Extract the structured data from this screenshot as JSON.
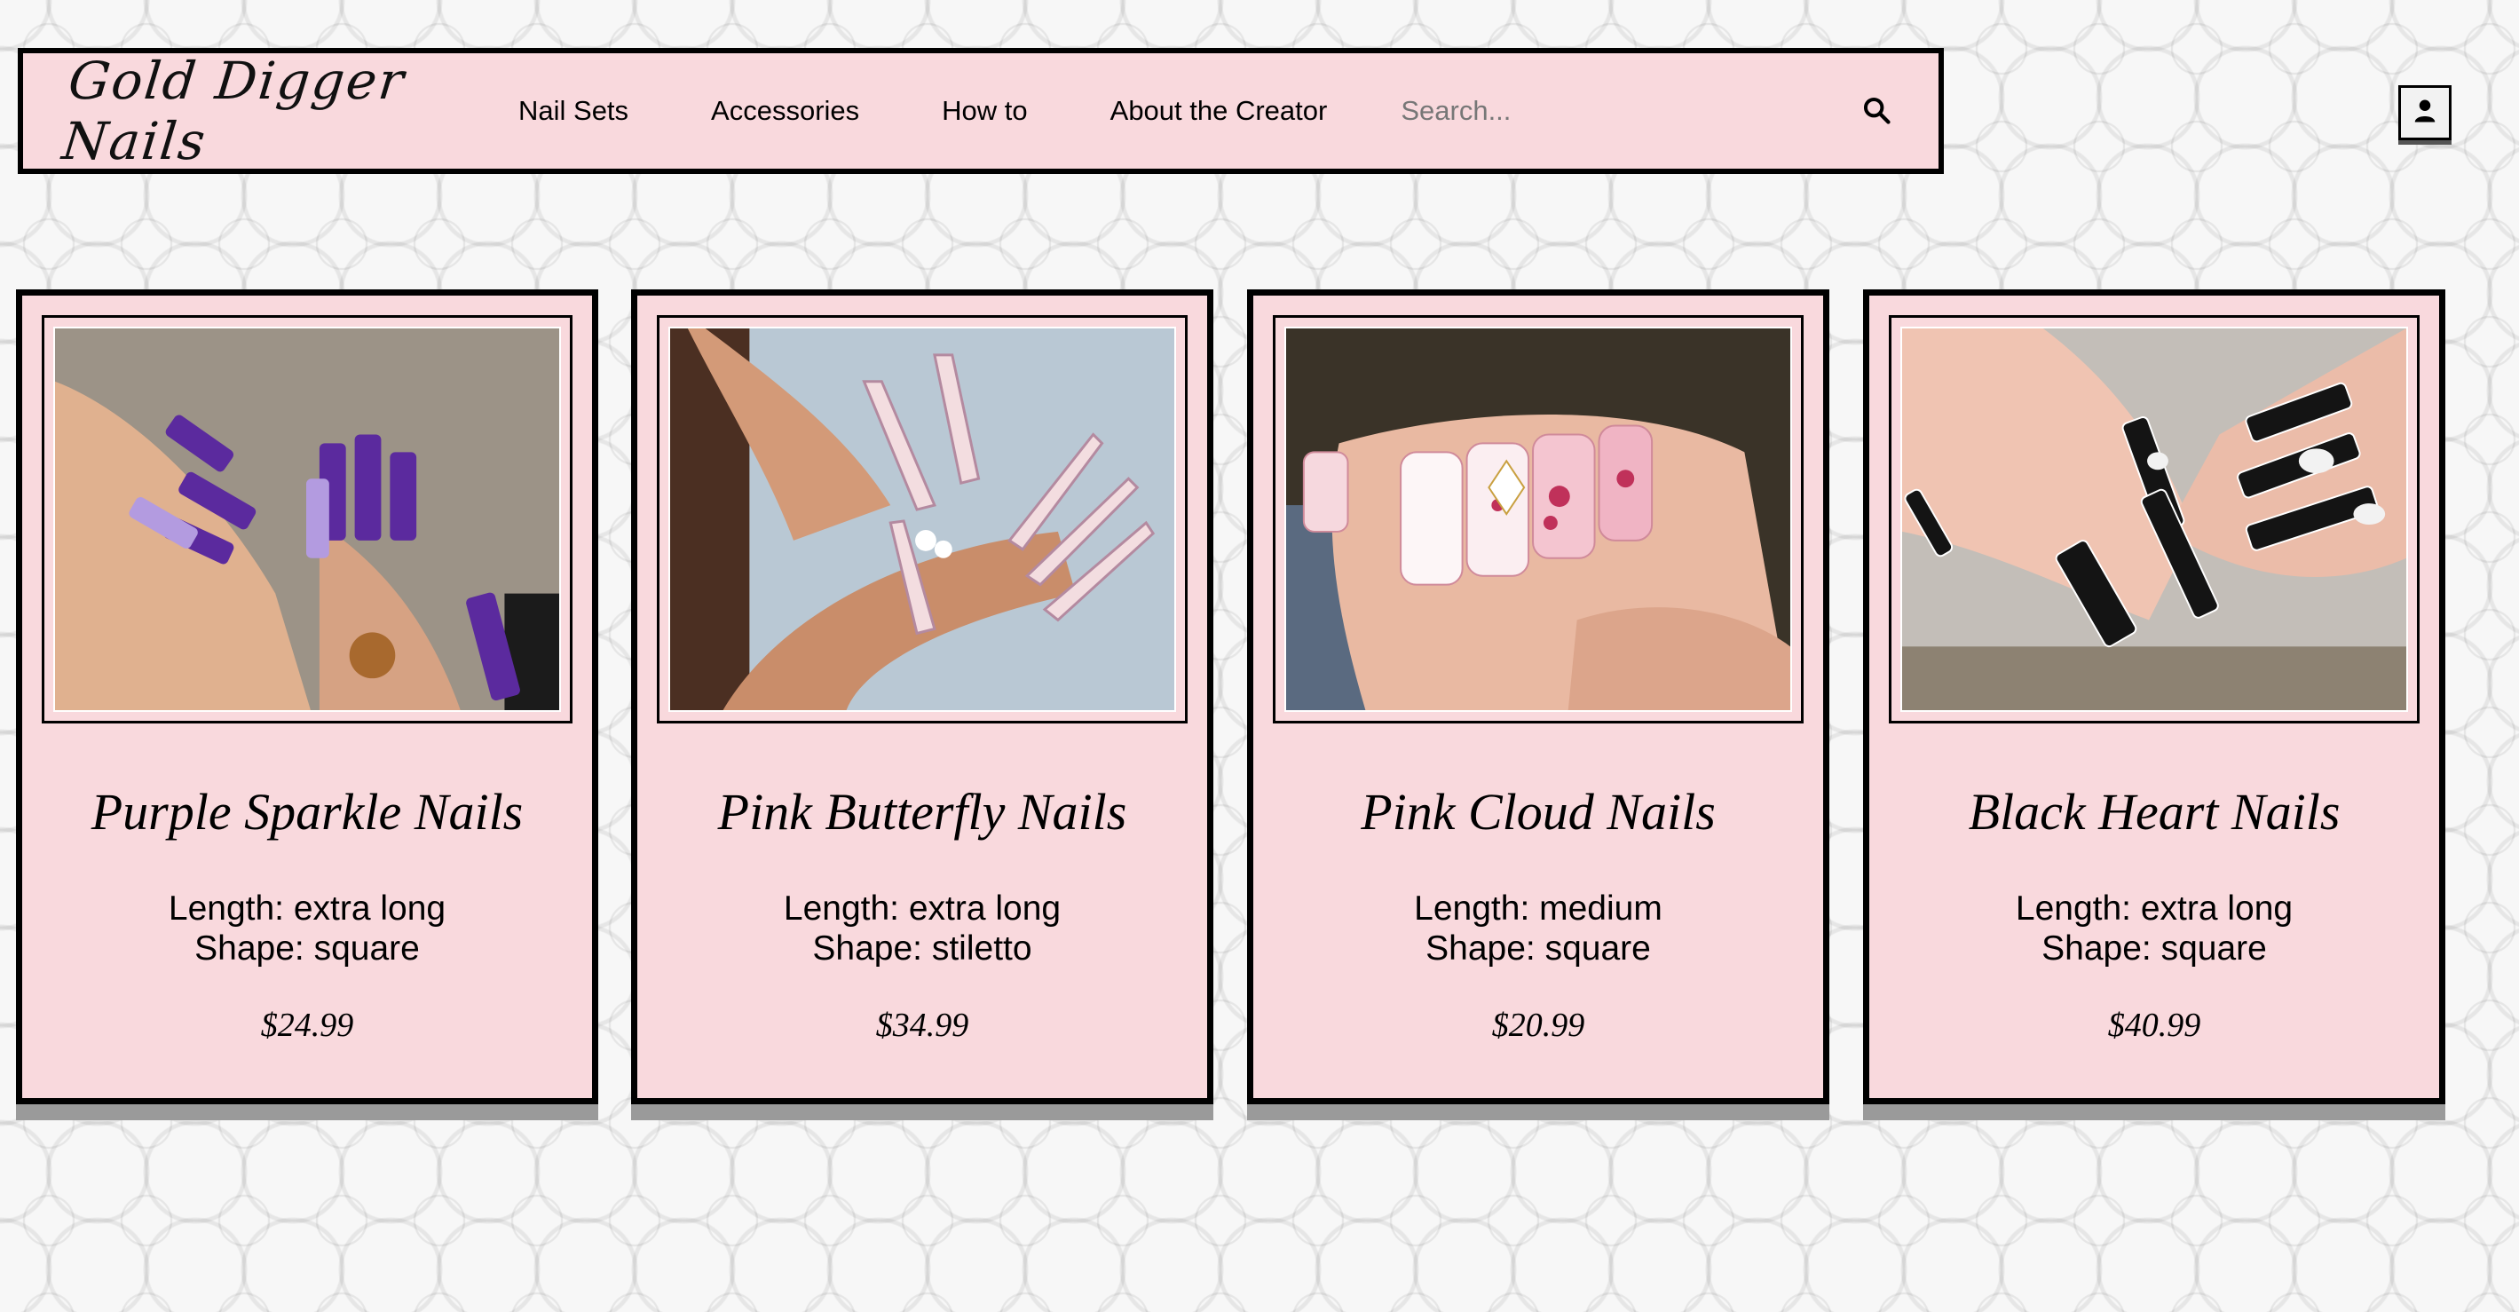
{
  "header": {
    "logo": "Gold Digger Nails",
    "nav": [
      "Nail Sets",
      "Accessories",
      "How to",
      "About the Creator"
    ],
    "search_placeholder": "Search..."
  },
  "icons": {
    "search": "search-icon",
    "account": "user-icon"
  },
  "colors": {
    "accent_pink": "#f9d9dd",
    "border": "#000000"
  },
  "products": [
    {
      "title": "Purple Sparkle Nails",
      "length": "Length: extra long",
      "shape": "Shape: square",
      "price": "$24.99"
    },
    {
      "title": "Pink Butterfly Nails",
      "length": "Length: extra long",
      "shape": "Shape: stiletto",
      "price": "$34.99"
    },
    {
      "title": "Pink Cloud Nails",
      "length": "Length: medium",
      "shape": "Shape: square",
      "price": "$20.99"
    },
    {
      "title": "Black Heart Nails",
      "length": "Length: extra long",
      "shape": "Shape: square",
      "price": "$40.99"
    }
  ]
}
